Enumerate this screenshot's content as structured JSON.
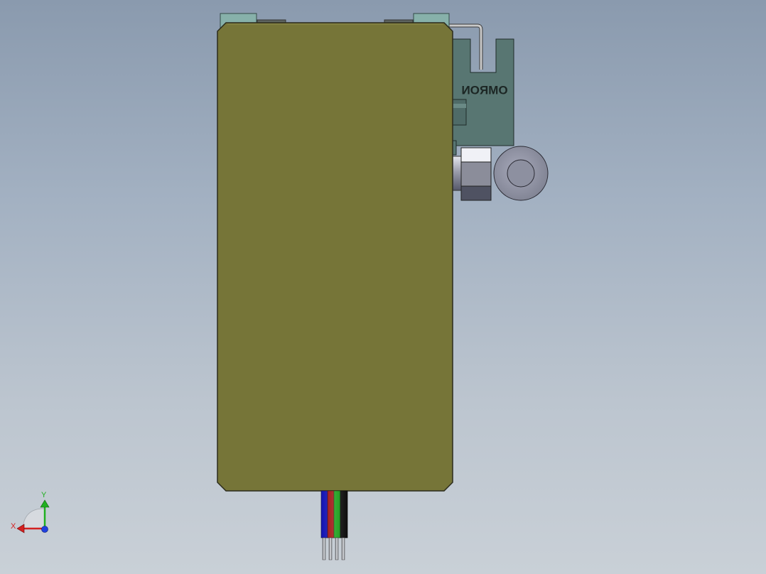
{
  "scene": {
    "brand_text": "OMRON",
    "colors": {
      "background_top": "#8a9aae",
      "background_bottom": "#c9d0d7",
      "housing_body": "#767538",
      "housing_edge": "#2b2b1c",
      "sensor_body": "#587672",
      "sensor_clip": "#87b1aa",
      "wire_blue": "#1414b4",
      "wire_red": "#a01010",
      "wire_green": "#14a014",
      "wire_black": "#101010"
    },
    "cable": {
      "wires": [
        "blue",
        "red",
        "green",
        "black"
      ]
    }
  },
  "triad": {
    "x_label": "X",
    "y_label": "Y",
    "x_color": "#d42020",
    "y_color": "#20b020",
    "z_color": "#2040e0"
  }
}
